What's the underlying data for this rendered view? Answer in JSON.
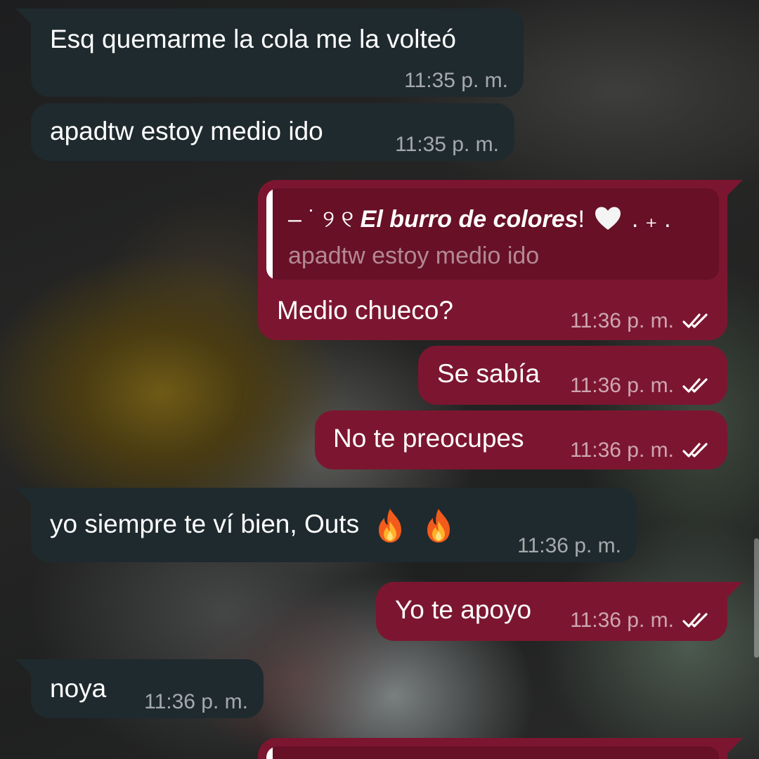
{
  "messages": [
    {
      "id": 1,
      "direction": "incoming",
      "text": "Esq quemarme la cola me la volteó",
      "time": "11:35 p. m."
    },
    {
      "id": 2,
      "direction": "incoming",
      "text": "apadtw estoy medio ido",
      "time": "11:35 p. m."
    },
    {
      "id": 3,
      "direction": "outgoing",
      "reply": {
        "author_prefix": "– ˙ ୨ ୧ ",
        "author_name": "El burro de colores",
        "author_suffix": "!",
        "author_trail": " . ₊  .",
        "quoted_text": "apadtw estoy medio ido"
      },
      "text": "Medio chueco?",
      "time": "11:36 p. m.",
      "status": "read"
    },
    {
      "id": 4,
      "direction": "outgoing",
      "text": "Se sabía",
      "time": "11:36 p. m.",
      "status": "read"
    },
    {
      "id": 5,
      "direction": "outgoing",
      "text": "No te preocupes",
      "time": "11:36 p. m.",
      "status": "read"
    },
    {
      "id": 6,
      "direction": "incoming",
      "text": "yo siempre te ví bien, Outs",
      "emoji": [
        "fire-icon",
        "fire-icon"
      ],
      "time": "11:36 p. m."
    },
    {
      "id": 7,
      "direction": "outgoing",
      "text": "Yo te apoyo",
      "time": "11:36 p. m.",
      "status": "read"
    },
    {
      "id": 8,
      "direction": "incoming",
      "text": "noya",
      "time": "11:36 p. m."
    }
  ],
  "colors": {
    "incoming_bubble": "#1f2a2e",
    "outgoing_bubble": "#7c1630",
    "reply_box": "#671026",
    "read_ticks": "#ffffff"
  },
  "icons": {
    "read_status": "double-check-icon",
    "reaction_emoji": "fire-icon",
    "heart": "white-heart-icon"
  }
}
